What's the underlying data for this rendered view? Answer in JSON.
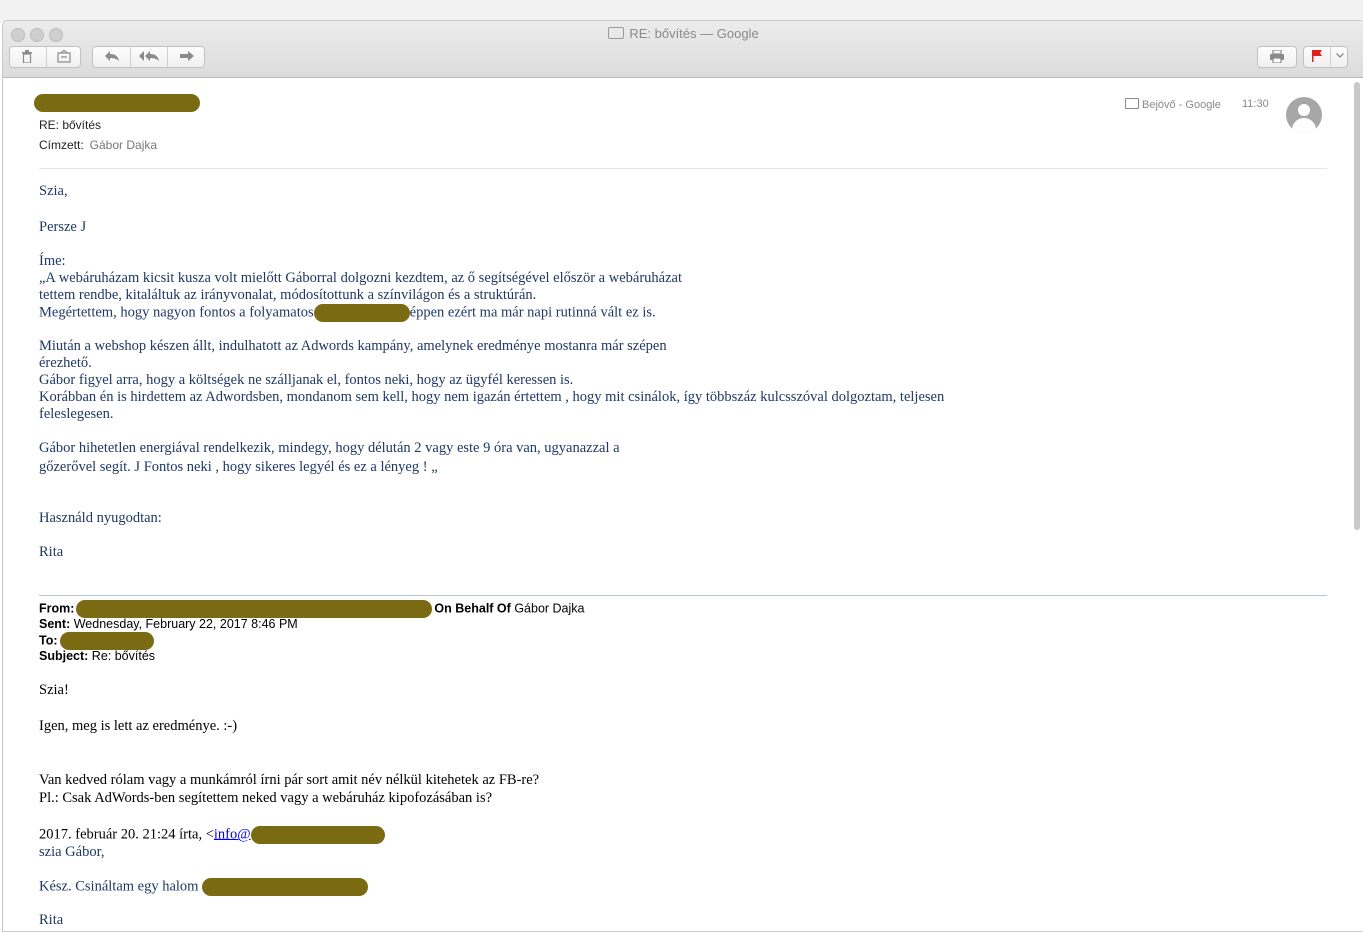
{
  "window": {
    "title": "RE: bővítés — Google"
  },
  "toolbar": {
    "trash_icon": "trash-icon",
    "junk_icon": "junk-icon",
    "reply_icon": "reply-icon",
    "reply_all_icon": "reply-all-icon",
    "forward_icon": "forward-icon",
    "print_icon": "print-icon",
    "flag_icon": "flag-icon",
    "flag_color": "#e0201b"
  },
  "message": {
    "subject": "RE: bővítés",
    "to_label": "Címzett:",
    "to_name": "Gábor Dajka",
    "mailbox": "Bejövő - Google",
    "time": "11:30"
  },
  "body": {
    "greeting": "Szia,",
    "line_persze": "Persze J",
    "ime": "Íme:",
    "p1_l1": "„A webáruházam kicsit kusza volt mielőtt Gáborral dolgozni kezdtem, az ő segítségével először a webáruházat",
    "p1_l2": "tettem rendbe, kitaláltuk az irányvonalat, módosítottunk a színvilágon és a struktúrán.",
    "p1_l3a": "Megértettem, hogy nagyon fontos a folyamatos",
    "p1_l3b": "éppen ezért ma már napi rutinná vált ez is.",
    "p2_l1": "Miután a webshop készen állt, indulhatott az Adwords kampány, amelynek eredménye mostanra már szépen",
    "p2_l2": "érezhető.",
    "p2_l3": "Gábor figyel arra, hogy a költségek ne szálljanak el, fontos neki, hogy az ügyfél keressen is.",
    "p2_l4": "Korábban én is hirdettem az Adwordsben, mondanom sem kell, hogy nem igazán értettem , hogy mit csinálok, így többszáz kulcsszóval dolgoztam, teljesen",
    "p2_l5": "feleslegesen.",
    "p3_l1": "Gábor hihetetlen energiával rendelkezik, mindegy, hogy délután 2 vagy este 9 óra van, ugyanazzal a",
    "p3_l2": "gőzerővel segít. J Fontos neki , hogy sikeres legyél és ez a lényeg ! „",
    "closing": "Használd nyugodtan:",
    "signature": "Rita"
  },
  "quoted": {
    "from_label": "From:",
    "on_behalf_label": "On Behalf Of",
    "on_behalf_name": "Gábor Dajka",
    "sent_label": "Sent:",
    "sent_value": "Wednesday, February 22, 2017 8:46 PM",
    "to_label": "To:",
    "subject_label": "Subject:",
    "subject_value": "Re: bővítés",
    "greeting": "Szia!",
    "line1": "Igen, meg is lett az eredménye. :-)",
    "line2": "Van kedved rólam vagy a munkámról írni pár sort amit név nélkül kitehetek az FB-re?",
    "line3": "Pl.: Csak AdWords-ben segítettem neked vagy a webáruház kipofozásában is?",
    "attribution": "2017. február 20. 21:24 írta, <",
    "attribution_link": "info@",
    "nested_greeting": "szia Gábor,",
    "nested_line": "Kész. Csináltam egy halom",
    "nested_signature": "Rita"
  }
}
